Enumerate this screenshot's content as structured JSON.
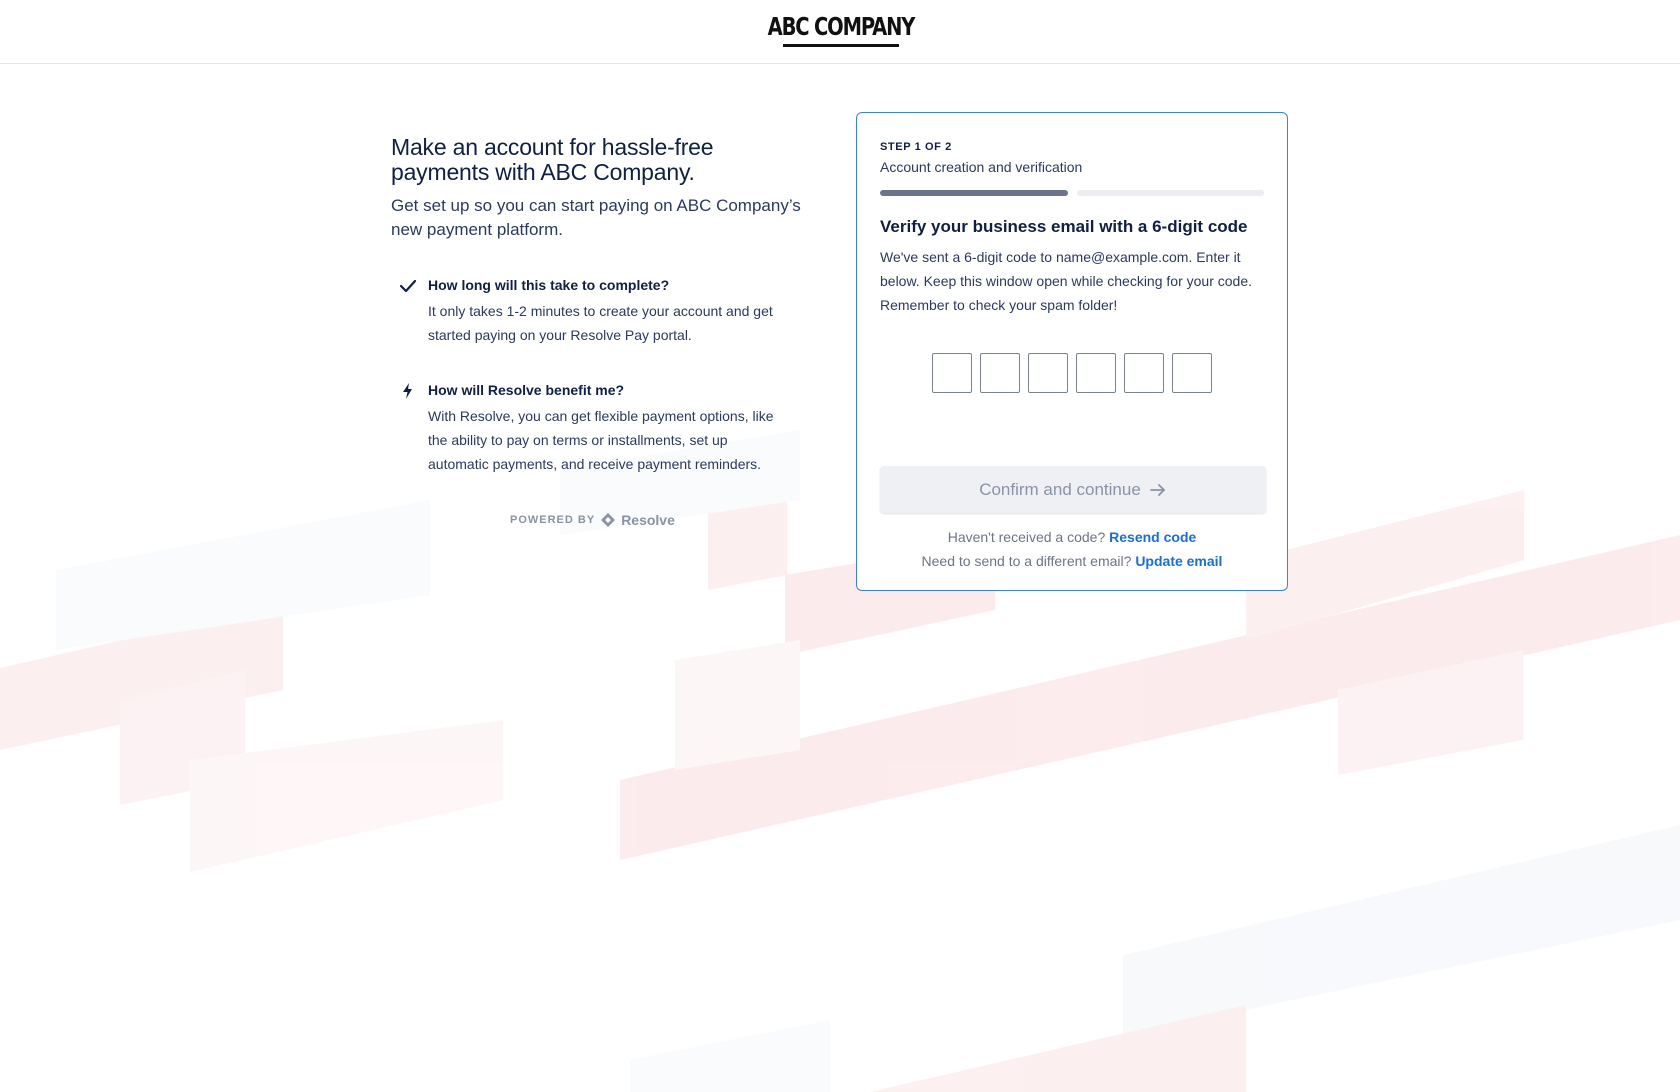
{
  "header": {
    "logo_text": "ABC COMPANY"
  },
  "intro": {
    "headline": "Make an account for hassle-free payments with ABC Company.",
    "subhead": "Get set up so you can start paying on ABC Company’s new payment platform."
  },
  "features": [
    {
      "icon": "check-icon",
      "title": "How long will this take to complete?",
      "body": "It only takes 1-2 minutes to create your account and get started paying on your Resolve Pay portal."
    },
    {
      "icon": "lightning-icon",
      "title": "How will Resolve benefit me?",
      "body": "With Resolve, you can get flexible payment options, like the ability to pay on terms or installments, set up automatic payments, and receive payment reminders."
    }
  ],
  "powered_by": {
    "label": "POWERED BY",
    "brand": "Resolve"
  },
  "card": {
    "step_label": "STEP 1 OF 2",
    "step_description": "Account creation and verification",
    "progress_fraction": 0.5,
    "verify_title": "Verify your business email with a 6-digit code",
    "verify_body": "We've sent a 6-digit code to name@example.com. Enter it below. Keep this window open while checking for your code. Remember to check your spam folder!",
    "code_digits": [
      "",
      "",
      "",
      "",
      "",
      ""
    ],
    "confirm_label": "Confirm and continue",
    "resend_prompt": "Haven't received a code?",
    "resend_link": "Resend code",
    "update_prompt": "Need to send to a different email?",
    "update_link": "Update email"
  },
  "colors": {
    "accent_blue": "#1a6fd6",
    "card_border": "#3b82e0",
    "text_dark": "#0f1f45",
    "deco_red": "#f9d9dc",
    "deco_blue": "#eef2f8"
  }
}
